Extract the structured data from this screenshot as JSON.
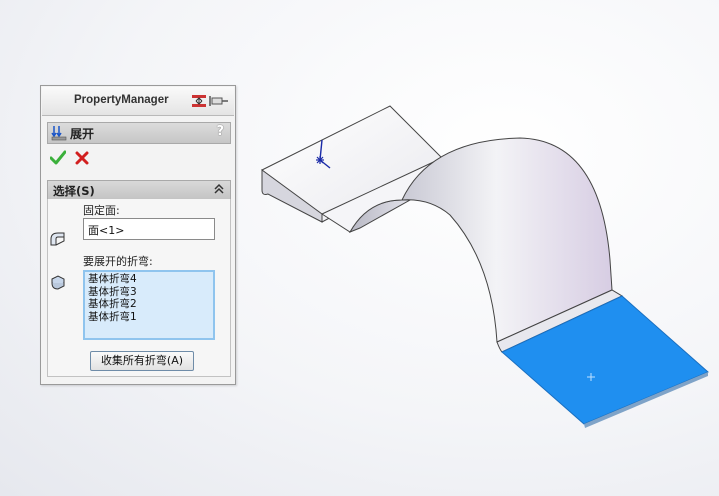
{
  "property_manager": {
    "title": "PropertyManager",
    "header_icons": [
      "pin-icon",
      "expand-panel-icon"
    ]
  },
  "feature": {
    "title": "展开",
    "icon": "unfold-icon",
    "help": "?"
  },
  "actions": {
    "ok_icon": "checkmark-icon",
    "cancel_icon": "cross-icon",
    "ok_color": "#3bb03b",
    "cancel_color": "#d21f1f"
  },
  "selection_group": {
    "title": "选择(S)",
    "fixed_face_label": "固定面:",
    "fixed_face_value": "面<1>",
    "bends_label": "要展开的折弯:",
    "bends": [
      "基体折弯4",
      "基体折弯3",
      "基体折弯2",
      "基体折弯1"
    ],
    "collect_button": "收集所有折弯(A)"
  },
  "colors": {
    "selected_face": "#1f8ff0",
    "list_highlight": "#d8ebfb",
    "list_border": "#8fc4ee"
  }
}
